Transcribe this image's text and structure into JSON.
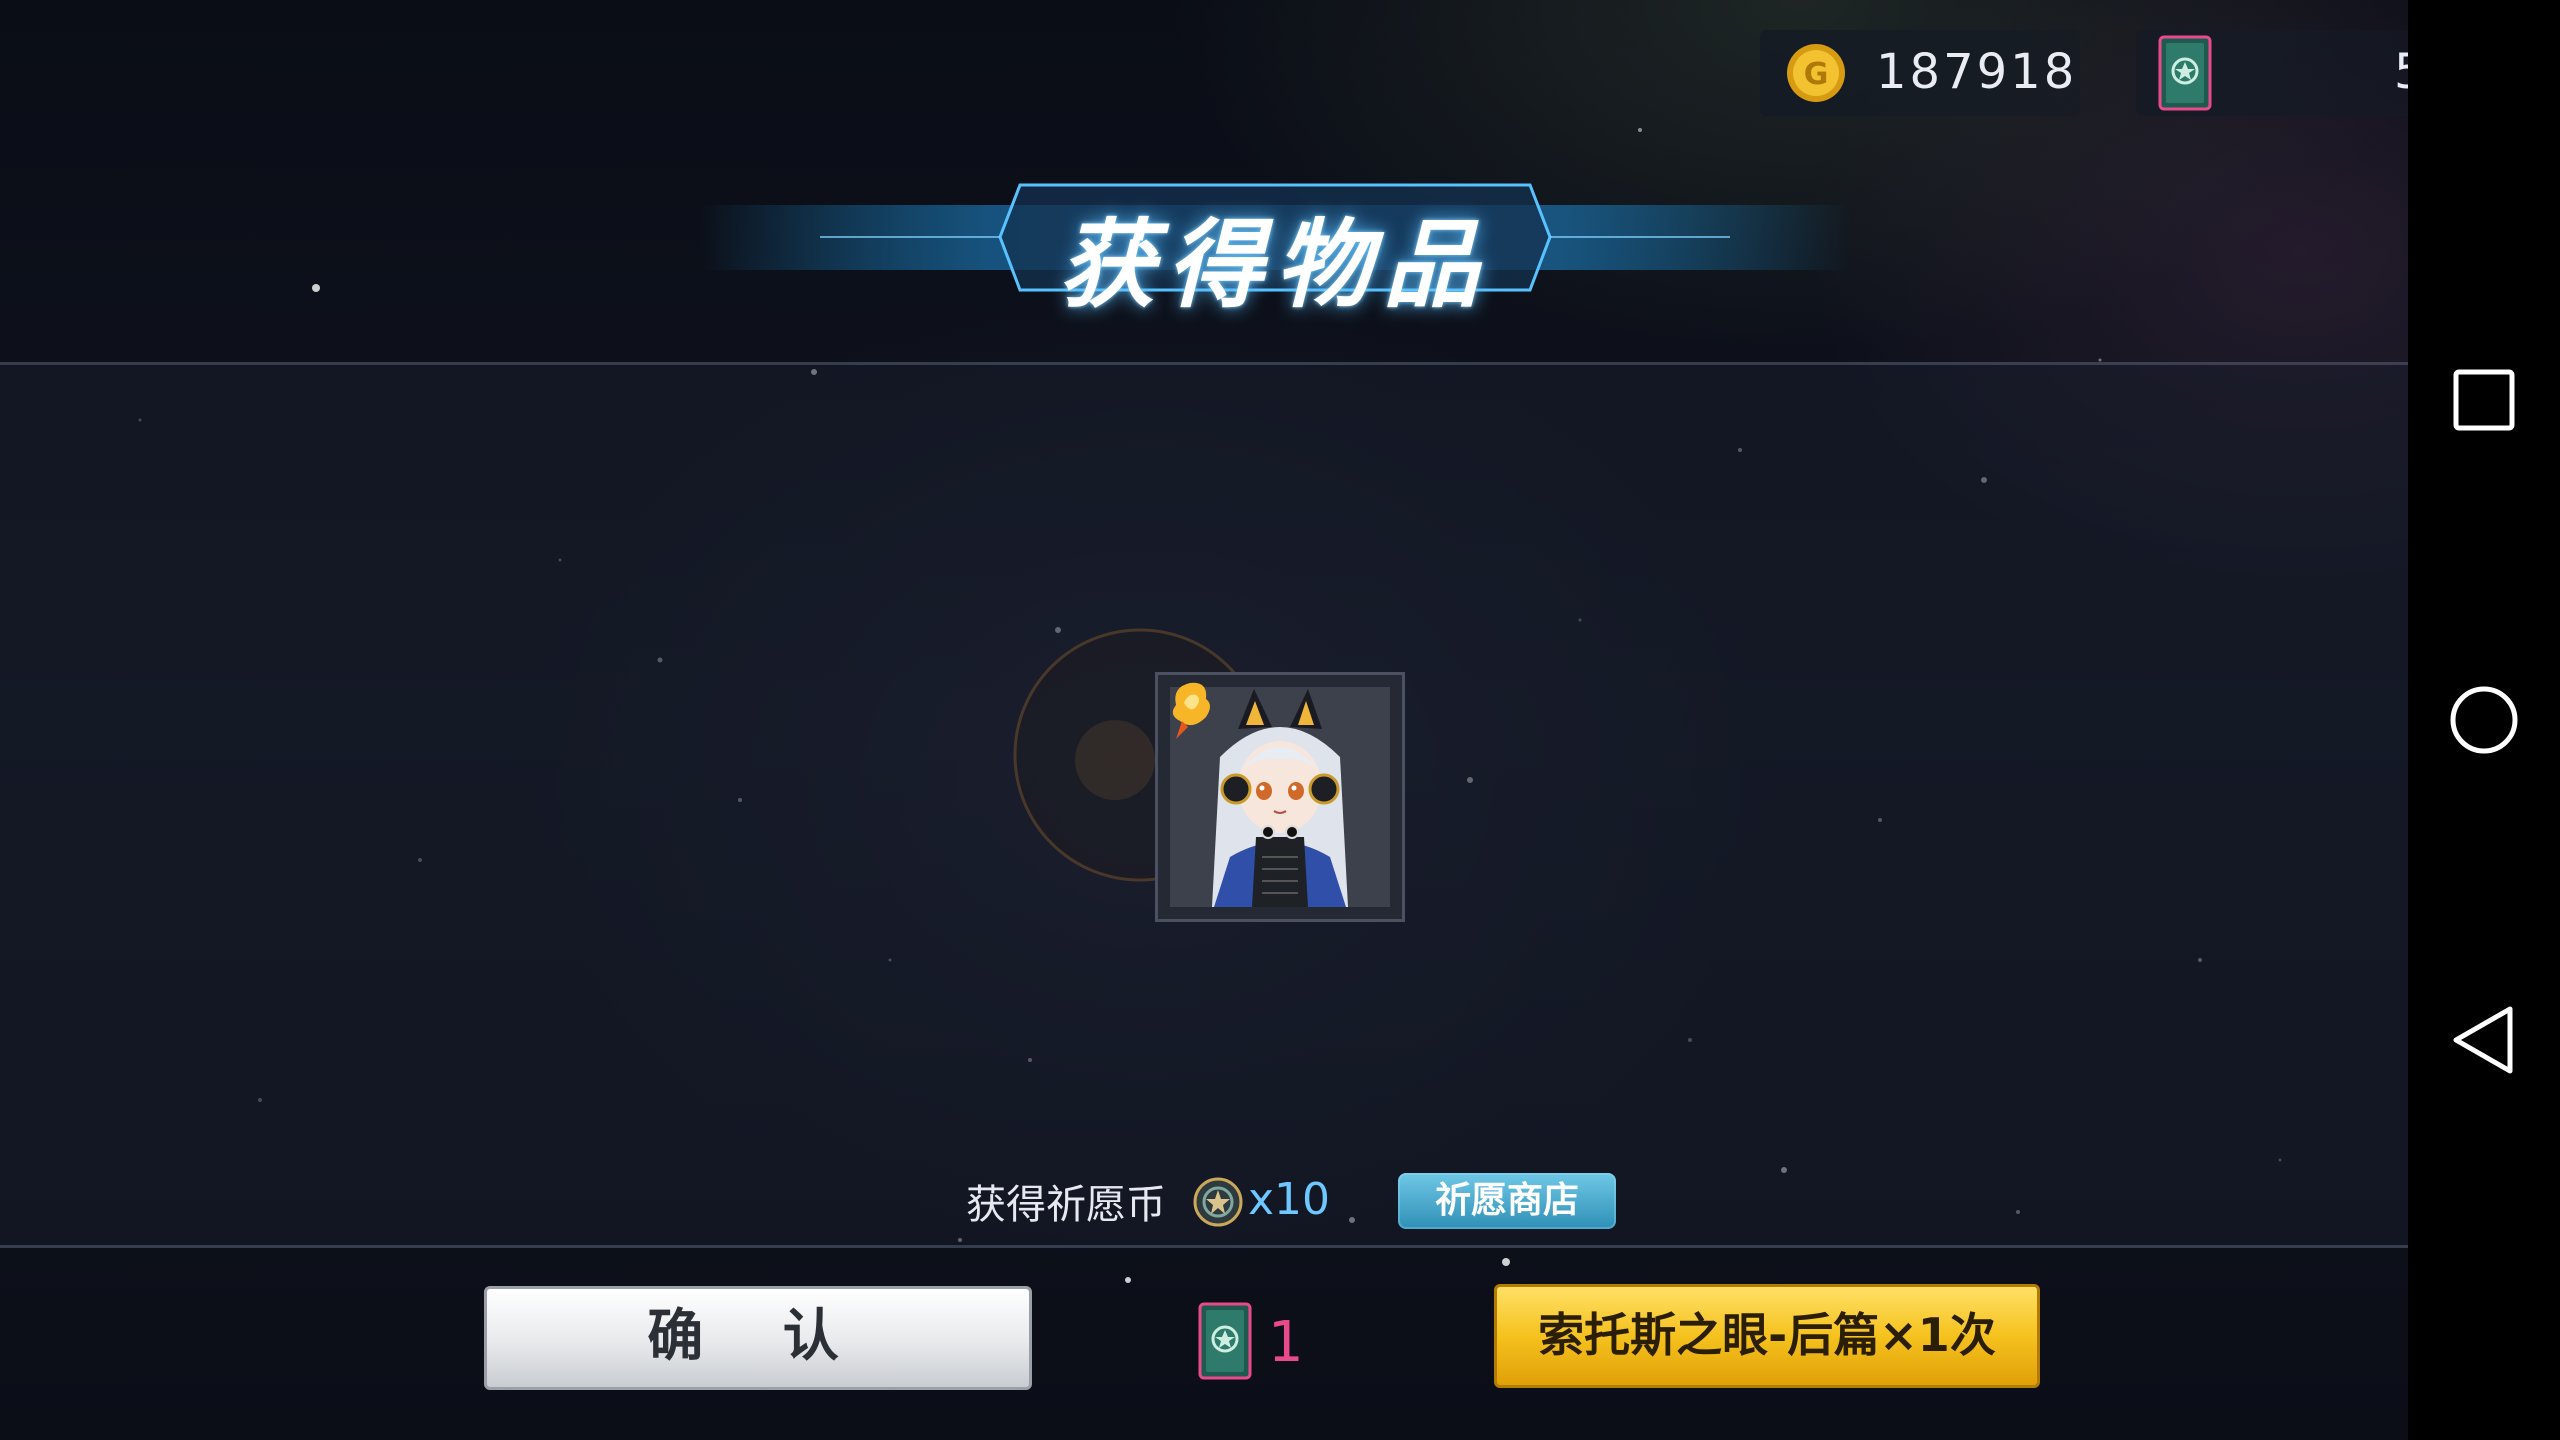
{
  "currency": {
    "gold_value": "187918",
    "ticket_value": "5"
  },
  "title": "获得物品",
  "reward": {
    "wish_label": "获得祈愿币",
    "wish_count": "x10",
    "shop_label": "祈愿商店"
  },
  "footer": {
    "confirm_label": "确 认",
    "ticket_count": "1",
    "draw_label": "索托斯之眼-后篇×1次"
  },
  "colors": {
    "gold_coin": "#f2c230",
    "ticket_pink": "#e84a8c",
    "title_glow": "#5abeff",
    "draw_button": "#f5c21e",
    "shop_button": "#3fa0c6"
  },
  "icons": [
    "gold-coin-icon",
    "ticket-card-icon",
    "wish-coin-icon",
    "square-nav-icon",
    "circle-nav-icon",
    "back-triangle-icon"
  ]
}
